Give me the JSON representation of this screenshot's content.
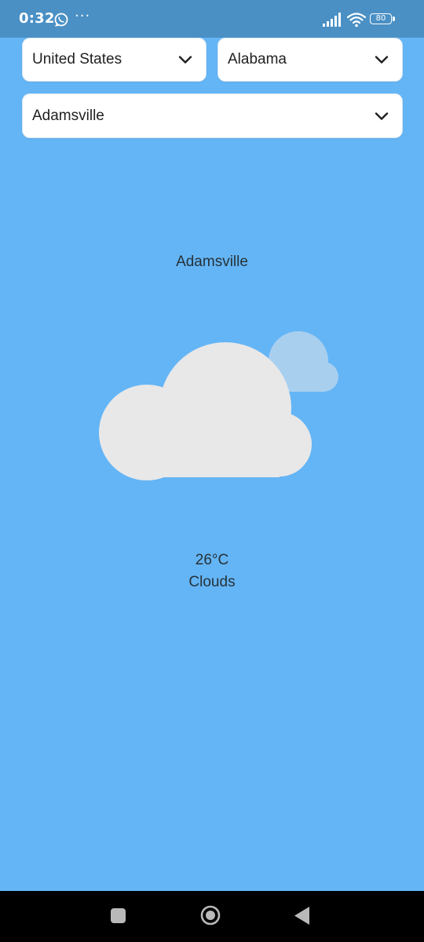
{
  "status_bar": {
    "time": "0:32",
    "notification_icons": [
      "whatsapp-icon"
    ],
    "more_indicator": "···",
    "signal_icon": "signal-icon",
    "wifi_icon": "wifi-icon",
    "battery_level": "80"
  },
  "selectors": {
    "country": {
      "value": "United States",
      "icon": "chevron-down-icon"
    },
    "state": {
      "value": "Alabama",
      "icon": "chevron-down-icon"
    },
    "city": {
      "value": "Adamsville",
      "icon": "chevron-down-icon"
    }
  },
  "weather": {
    "location": "Adamsville",
    "icon": "clouds-icon",
    "temperature": "26°C",
    "condition": "Clouds"
  },
  "nav_bar": {
    "recents_icon": "square-icon",
    "home_icon": "circle-icon",
    "back_icon": "triangle-back-icon"
  },
  "colors": {
    "background": "#64b5f6",
    "status_bar": "#4a90c4",
    "cloud_front": "#e8e8e8",
    "cloud_back": "#a9cfef",
    "nav_bar": "#000000"
  }
}
